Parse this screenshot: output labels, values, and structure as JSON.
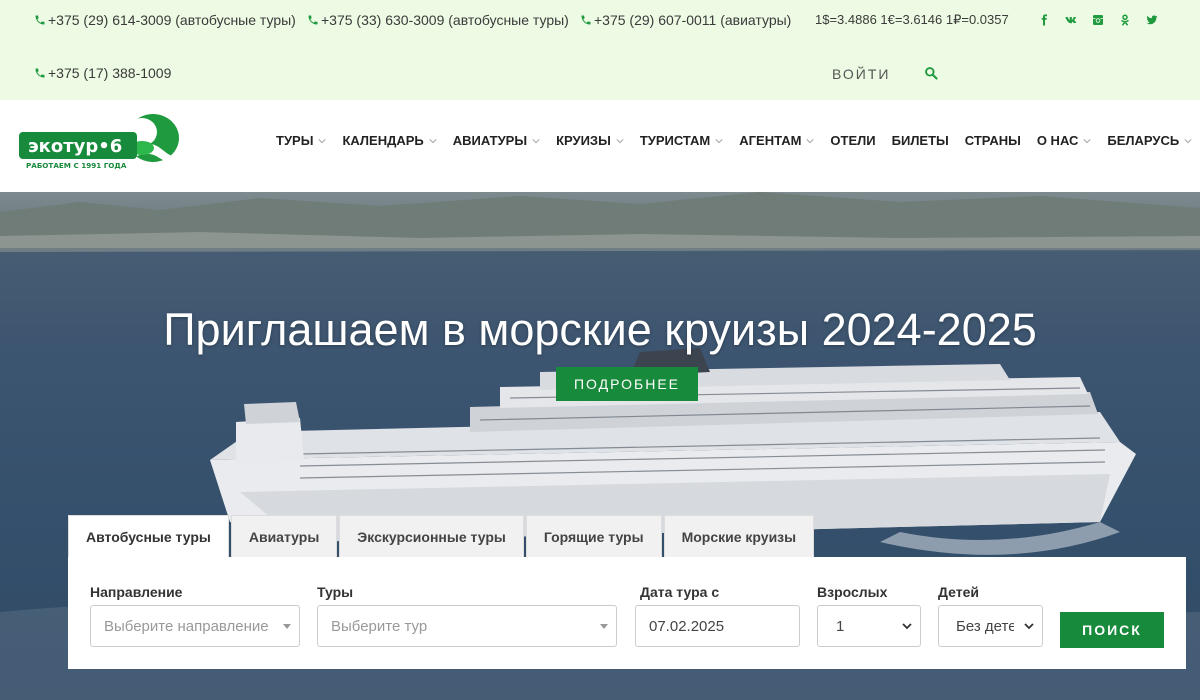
{
  "topbar": {
    "phones": [
      "+375 (29) 614-3009 (автобусные туры)",
      "+375 (33) 630-3009 (автобусные туры)",
      "+375 (29) 607-0011 (авиатуры)",
      "+375 (17) 388-1009"
    ],
    "rates": "1$=3.4886 1€=3.6146 1₽=0.0357",
    "login": "ВОЙТИ",
    "socials": [
      "facebook-icon",
      "vk-icon",
      "instagram-icon",
      "odnoklassniki-icon",
      "twitter-icon"
    ],
    "search_icon": "search-icon"
  },
  "logo": {
    "name": "экотур•6",
    "tagline": "РАБОТАЕМ С 1991 ГОДА"
  },
  "menu": [
    {
      "label": "ТУРЫ",
      "dropdown": true
    },
    {
      "label": "КАЛЕНДАРЬ",
      "dropdown": true
    },
    {
      "label": "АВИАТУРЫ",
      "dropdown": true
    },
    {
      "label": "КРУИЗЫ",
      "dropdown": true
    },
    {
      "label": "ТУРИСТАМ",
      "dropdown": true
    },
    {
      "label": "АГЕНТАМ",
      "dropdown": true
    },
    {
      "label": "ОТЕЛИ",
      "dropdown": false
    },
    {
      "label": "БИЛЕТЫ",
      "dropdown": false
    },
    {
      "label": "СТРАНЫ",
      "dropdown": false
    },
    {
      "label": "О НАС",
      "dropdown": true
    },
    {
      "label": "БЕЛАРУСЬ",
      "dropdown": true
    }
  ],
  "hero": {
    "title": "Приглашаем в морские круизы 2024-2025",
    "more_button": "ПОДРОБНЕЕ"
  },
  "search": {
    "tabs": [
      "Автобусные туры",
      "Авиатуры",
      "Экскурсионные туры",
      "Горящие туры",
      "Морские круизы"
    ],
    "active_tab": "Автобусные туры",
    "direction": {
      "label": "Направление",
      "placeholder": "Выберите направление"
    },
    "tours": {
      "label": "Туры",
      "placeholder": "Выберите тур"
    },
    "date": {
      "label": "Дата тура с",
      "value": "07.02.2025"
    },
    "adults": {
      "label": "Взрослых",
      "value": "1"
    },
    "children": {
      "label": "Детей",
      "value": "Без детей"
    },
    "submit": "ПОИСК"
  },
  "colors": {
    "brand_green": "#188a3c",
    "topbar_bg": "#edfbe4",
    "icon_green": "#1f9a3e"
  }
}
